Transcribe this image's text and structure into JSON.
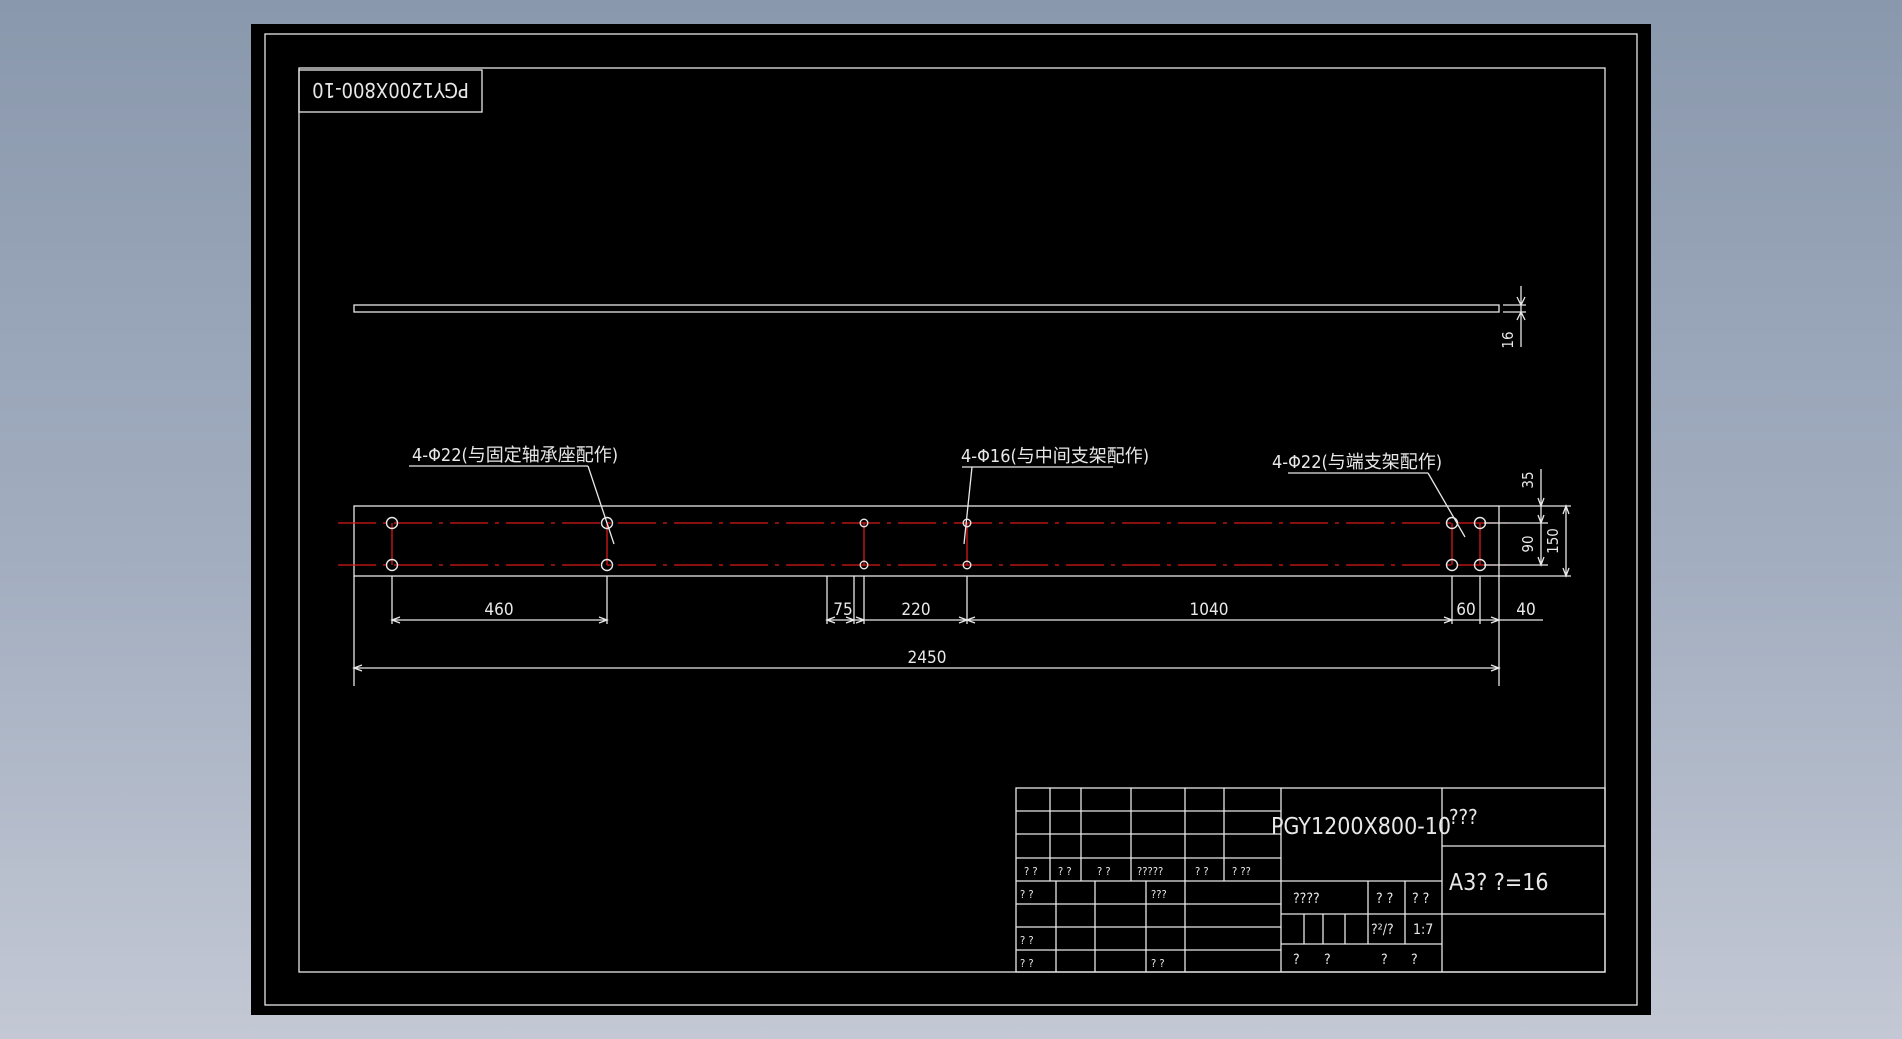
{
  "colors": {
    "outline": "#e8e8e8",
    "centerline": "#d81818",
    "paper": "#000000"
  },
  "stamp_text": "PGY1200X800-10",
  "top_view": {
    "thickness_dim": "16"
  },
  "callouts": {
    "left": "4-Φ22(与固定轴承座配作)",
    "mid": "4-Φ16(与中间支架配作)",
    "right": "4-Φ22(与端支架配作)"
  },
  "dims": {
    "d460": "460",
    "d75": "75",
    "d220": "220",
    "d1040": "1040",
    "d60": "60",
    "d40": "40",
    "d2450": "2450",
    "d35": "35",
    "d90": "90",
    "d150": "150"
  },
  "title_block": {
    "drawing_no": "PGY1200X800-10",
    "part_name": "???",
    "material": "A3? ?=16",
    "row_a": [
      "? ?",
      "? ?",
      "? ?",
      "?????",
      "? ?",
      "? ??"
    ],
    "row_b": [
      "? ?",
      "???"
    ],
    "row_c": [
      "? ?"
    ],
    "row_d": [
      "? ?",
      "? ?"
    ],
    "stage": "????",
    "weight": "? ?",
    "scale_lbl": "? ?",
    "sheet": "?²/?",
    "scale": "1:7",
    "footer": [
      "?",
      "?",
      "?",
      "?"
    ]
  }
}
